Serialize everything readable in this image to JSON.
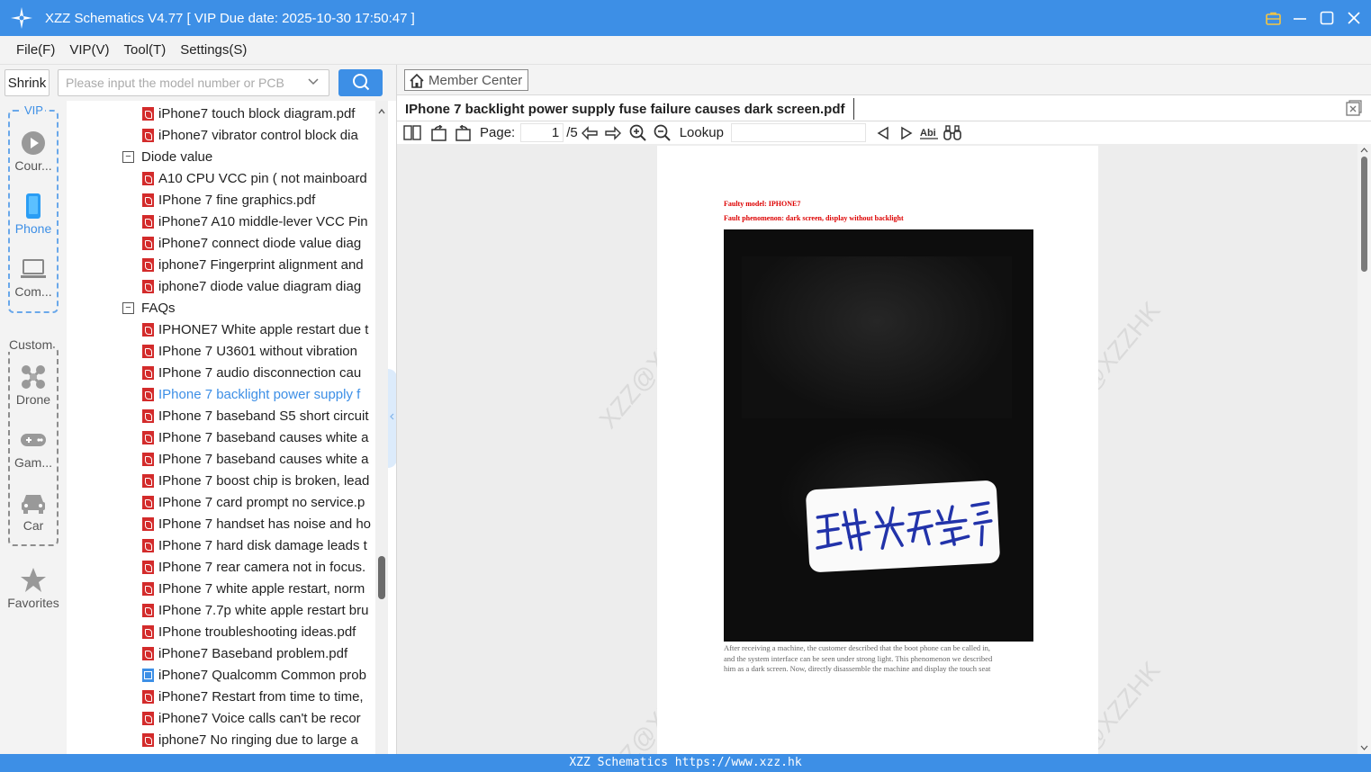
{
  "app": {
    "title": "XZZ Schematics V4.77 [ VIP Due date: 2025-10-30 17:50:47 ]",
    "accent_color": "#3d8fe6"
  },
  "menu": [
    "File(F)",
    "VIP(V)",
    "Tool(T)",
    "Settings(S)"
  ],
  "search": {
    "shrink_label": "Shrink",
    "placeholder": "Please input the model number or PCB",
    "button_icon": "search-icon"
  },
  "categories": {
    "vip_label": "VIP",
    "vip_items": [
      {
        "label": "Cour...",
        "icon": "play-icon"
      },
      {
        "label": "Phone",
        "icon": "phone-icon",
        "active": true
      },
      {
        "label": "Com...",
        "icon": "laptop-icon"
      }
    ],
    "custom_label": "Custom",
    "custom_items": [
      {
        "label": "Drone",
        "icon": "drone-icon"
      },
      {
        "label": "Gam...",
        "icon": "gamepad-icon"
      },
      {
        "label": "Car",
        "icon": "car-icon"
      }
    ],
    "favorites_label": "Favorites"
  },
  "tree": {
    "rows": [
      {
        "type": "pdf",
        "text": "iPhone7 touch block diagram.pdf"
      },
      {
        "type": "pdf",
        "text": "iPhone7 vibrator control block dia"
      },
      {
        "type": "folder",
        "text": "Diode value"
      },
      {
        "type": "pdf",
        "text": "A10 CPU VCC pin ( not mainboard"
      },
      {
        "type": "pdf",
        "text": "IPhone 7 fine graphics.pdf"
      },
      {
        "type": "pdf",
        "text": "iPhone7 A10 middle-lever VCC Pin"
      },
      {
        "type": "pdf",
        "text": "iPhone7 connect diode value diag"
      },
      {
        "type": "pdf",
        "text": "iphone7 Fingerprint alignment and"
      },
      {
        "type": "pdf",
        "text": "iphone7 diode value diagram diag"
      },
      {
        "type": "folder",
        "text": "FAQs"
      },
      {
        "type": "pdf",
        "text": "IPHONE7 White apple restart due t"
      },
      {
        "type": "pdf",
        "text": "IPhone 7 U3601 without vibration"
      },
      {
        "type": "pdf",
        "text": "IPhone 7 audio disconnection cau"
      },
      {
        "type": "pdf",
        "text": "IPhone 7 backlight power supply f",
        "selected": true
      },
      {
        "type": "pdf",
        "text": "IPhone 7 baseband S5 short circuit"
      },
      {
        "type": "pdf",
        "text": "IPhone 7 baseband causes white a"
      },
      {
        "type": "pdf",
        "text": "IPhone 7 baseband causes white a"
      },
      {
        "type": "pdf",
        "text": "IPhone 7 boost chip is broken, lead"
      },
      {
        "type": "pdf",
        "text": "IPhone 7 card prompt no service.p"
      },
      {
        "type": "pdf",
        "text": "IPhone 7 handset has noise and ho"
      },
      {
        "type": "pdf",
        "text": "IPhone 7 hard disk damage leads t"
      },
      {
        "type": "pdf",
        "text": "IPhone 7 rear camera not in focus."
      },
      {
        "type": "pdf",
        "text": "IPhone 7 white apple restart, norm"
      },
      {
        "type": "pdf",
        "text": "IPhone 7.7p white apple restart bru"
      },
      {
        "type": "pdf",
        "text": "IPhone troubleshooting ideas.pdf"
      },
      {
        "type": "pdf",
        "text": "iPhone7 Baseband problem.pdf"
      },
      {
        "type": "img",
        "text": "iPhone7 Qualcomm Common prob"
      },
      {
        "type": "pdf",
        "text": "iPhone7 Restart from time to time,"
      },
      {
        "type": "pdf",
        "text": "iPhone7 Voice calls can't be recor"
      },
      {
        "type": "pdf",
        "text": "iphone7 No ringing due to large a"
      }
    ]
  },
  "viewer": {
    "member_center_label": "Member Center",
    "tab_title": "IPhone 7 backlight power supply fuse failure causes dark screen.pdf",
    "page_label": "Page:",
    "page_current": "1",
    "page_total": "/5",
    "lookup_label": "Lookup",
    "lookup_value": ""
  },
  "document": {
    "faulty_model": "Faulty model: IPHONE7",
    "fault_phenomenon": "Fault phenomenon: dark screen, display without backlight",
    "sticker_text": "主板 背光不亮",
    "body_lines": [
      "After receiving a machine, the customer described that the boot phone can be called in,",
      "and the system interface can be seen under strong light. This phenomenon we described",
      "him as a dark screen. Now, directly disassemble the machine and display the touch seat"
    ],
    "watermark": "XZZ@XZZHK"
  },
  "status": {
    "text": "XZZ Schematics https://www.xzz.hk"
  }
}
